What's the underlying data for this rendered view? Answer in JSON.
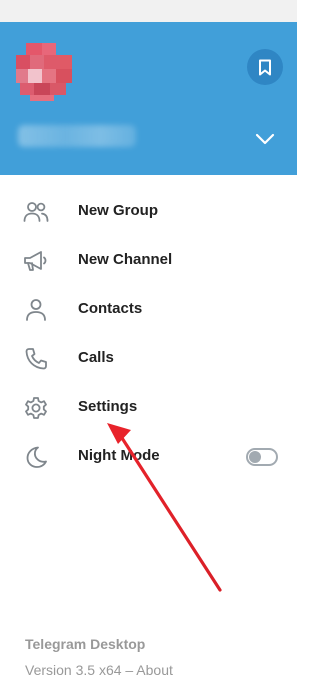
{
  "header": {
    "background_color": "#419fd9",
    "avatar_icon": "user-avatar-pixelated",
    "saved_messages_icon": "bookmark-icon",
    "expand_icon": "chevron-down-icon"
  },
  "menu": {
    "items": [
      {
        "label": "New Group",
        "icon": "people-icon"
      },
      {
        "label": "New Channel",
        "icon": "megaphone-icon"
      },
      {
        "label": "Contacts",
        "icon": "person-icon"
      },
      {
        "label": "Calls",
        "icon": "phone-icon"
      },
      {
        "label": "Settings",
        "icon": "gear-icon"
      },
      {
        "label": "Night Mode",
        "icon": "moon-icon"
      }
    ],
    "night_mode_enabled": false
  },
  "footer": {
    "app_name": "Telegram Desktop",
    "version_text": "Version 3.5 x64 – About"
  },
  "annotation": {
    "arrow_color": "#e8232b",
    "target": "Settings"
  }
}
